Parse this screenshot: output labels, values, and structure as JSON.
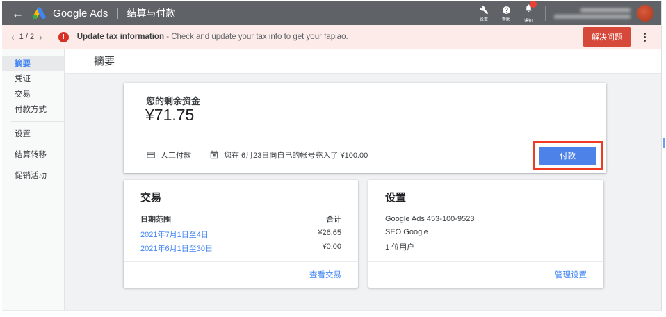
{
  "header": {
    "brand": "Google Ads",
    "title": "结算与付款",
    "tools": [
      {
        "label": "设置"
      },
      {
        "label": "帮助"
      },
      {
        "label": "通知",
        "badge": "!"
      }
    ]
  },
  "alert": {
    "pager": "1 / 2",
    "title": "Update tax information",
    "message": "- Check and update your tax info to get your fapiao.",
    "action_label": "解决问题"
  },
  "sidebar": {
    "items": [
      {
        "label": "摘要",
        "selected": true
      },
      {
        "label": "凭证"
      },
      {
        "label": "交易"
      },
      {
        "label": "付款方式"
      },
      {
        "label": "设置"
      },
      {
        "label": "结算转移"
      },
      {
        "label": "促销活动"
      }
    ]
  },
  "main": {
    "page_title": "摘要",
    "balance_card": {
      "title": "您的剩余资金",
      "amount": "¥71.75",
      "payment_mode": "人工付款",
      "last_payment_note": "您在 6月23日向自己的帐号充入了 ¥100.00",
      "pay_button": "付款"
    },
    "transactions_card": {
      "title": "交易",
      "col_date_range": "日期范围",
      "col_total": "合计",
      "rows": [
        {
          "range": "2021年7月1日至4日",
          "total": "¥26.65"
        },
        {
          "range": "2021年6月1日至30日",
          "total": "¥0.00"
        }
      ],
      "footer_link": "查看交易"
    },
    "settings_card": {
      "title": "设置",
      "account_id": "Google Ads 453-100-9523",
      "account_name": "SEO Google",
      "users_link": "1 位用户",
      "footer_link": "管理设置"
    }
  },
  "colors": {
    "header_bg": "#5f6368",
    "alert_bg": "#fcebe8",
    "alert_red": "#d93025",
    "link_blue": "#4285f4",
    "pay_button_blue": "#4d82e8",
    "annotation_red": "#ee3b22"
  }
}
